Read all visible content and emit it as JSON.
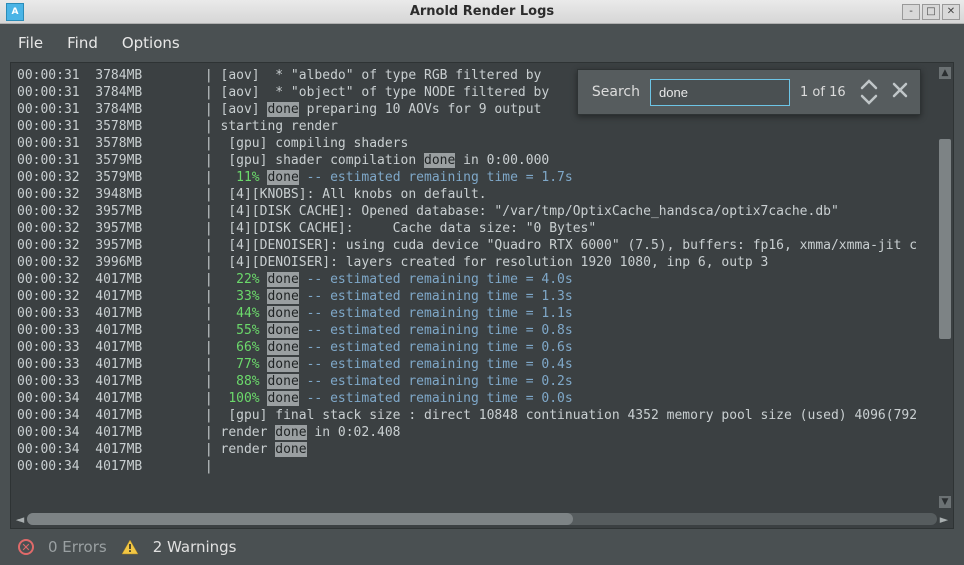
{
  "window": {
    "title": "Arnold Render Logs",
    "app_icon_text": "A"
  },
  "menu": {
    "file": "File",
    "find": "Find",
    "options": "Options"
  },
  "search": {
    "label": "Search",
    "value": "done",
    "count": "1 of 16"
  },
  "status": {
    "errors": "0 Errors",
    "warnings": "2 Warnings"
  },
  "highlight_word": "done",
  "log": [
    {
      "ts": "00:00:31",
      "mem": "3784MB",
      "pipe": true,
      "prefix": " [aov]  * \"albedo\" of type RGB filtered by"
    },
    {
      "ts": "00:00:31",
      "mem": "3784MB",
      "pipe": true,
      "prefix": " [aov]  * \"object\" of type NODE filtered by"
    },
    {
      "ts": "00:00:31",
      "mem": "3784MB",
      "pipe": true,
      "prefix": " [aov] ",
      "hl": "done",
      "suffix": " preparing 10 AOVs for 9 output"
    },
    {
      "ts": "00:00:31",
      "mem": "3578MB",
      "pipe": true,
      "prefix": " starting render"
    },
    {
      "ts": "00:00:31",
      "mem": "3578MB",
      "pipe": true,
      "prefix": "  [gpu] compiling shaders"
    },
    {
      "ts": "00:00:31",
      "mem": "3579MB",
      "pipe": true,
      "prefix": "  [gpu] shader compilation ",
      "hl": "done",
      "suffix": " in 0:00.000"
    },
    {
      "ts": "00:00:32",
      "mem": "3579MB",
      "pipe": true,
      "green": "   11% ",
      "hl": "done",
      "dim": " -- estimated remaining time = 1.7s"
    },
    {
      "ts": "00:00:32",
      "mem": "3948MB",
      "pipe": true,
      "prefix": "  [4][KNOBS]: All knobs on default."
    },
    {
      "ts": "00:00:32",
      "mem": "3957MB",
      "pipe": true,
      "prefix": "  [4][DISK CACHE]: Opened database: \"/var/tmp/OptixCache_handsca/optix7cache.db\""
    },
    {
      "ts": "00:00:32",
      "mem": "3957MB",
      "pipe": true,
      "prefix": "  [4][DISK CACHE]:     Cache data size: \"0 Bytes\""
    },
    {
      "ts": "00:00:32",
      "mem": "3957MB",
      "pipe": true,
      "prefix": "  [4][DENOISER]: using cuda device \"Quadro RTX 6000\" (7.5), buffers: fp16, xmma/xmma-jit c"
    },
    {
      "ts": "00:00:32",
      "mem": "3996MB",
      "pipe": true,
      "prefix": "  [4][DENOISER]: layers created for resolution 1920 1080, inp 6, outp 3"
    },
    {
      "ts": "00:00:32",
      "mem": "4017MB",
      "pipe": true,
      "green": "   22% ",
      "hl": "done",
      "dim": " -- estimated remaining time = 4.0s"
    },
    {
      "ts": "00:00:32",
      "mem": "4017MB",
      "pipe": true,
      "green": "   33% ",
      "hl": "done",
      "dim": " -- estimated remaining time = 1.3s"
    },
    {
      "ts": "00:00:33",
      "mem": "4017MB",
      "pipe": true,
      "green": "   44% ",
      "hl": "done",
      "dim": " -- estimated remaining time = 1.1s"
    },
    {
      "ts": "00:00:33",
      "mem": "4017MB",
      "pipe": true,
      "green": "   55% ",
      "hl": "done",
      "dim": " -- estimated remaining time = 0.8s"
    },
    {
      "ts": "00:00:33",
      "mem": "4017MB",
      "pipe": true,
      "green": "   66% ",
      "hl": "done",
      "dim": " -- estimated remaining time = 0.6s"
    },
    {
      "ts": "00:00:33",
      "mem": "4017MB",
      "pipe": true,
      "green": "   77% ",
      "hl": "done",
      "dim": " -- estimated remaining time = 0.4s"
    },
    {
      "ts": "00:00:33",
      "mem": "4017MB",
      "pipe": true,
      "green": "   88% ",
      "hl": "done",
      "dim": " -- estimated remaining time = 0.2s"
    },
    {
      "ts": "00:00:34",
      "mem": "4017MB",
      "pipe": true,
      "green": "  100% ",
      "hl": "done",
      "dim": " -- estimated remaining time = 0.0s"
    },
    {
      "ts": "00:00:34",
      "mem": "4017MB",
      "pipe": true,
      "prefix": "  [gpu] final stack size : direct 10848 continuation 4352 memory pool size (used) 4096(792"
    },
    {
      "ts": "00:00:34",
      "mem": "4017MB",
      "pipe": true,
      "prefix": " render ",
      "hl": "done",
      "suffix": " in 0:02.408"
    },
    {
      "ts": "00:00:34",
      "mem": "4017MB",
      "pipe": true,
      "prefix": " render ",
      "hl": "done"
    },
    {
      "ts": "00:00:34",
      "mem": "4017MB",
      "pipe": true,
      "prefix": ""
    }
  ]
}
